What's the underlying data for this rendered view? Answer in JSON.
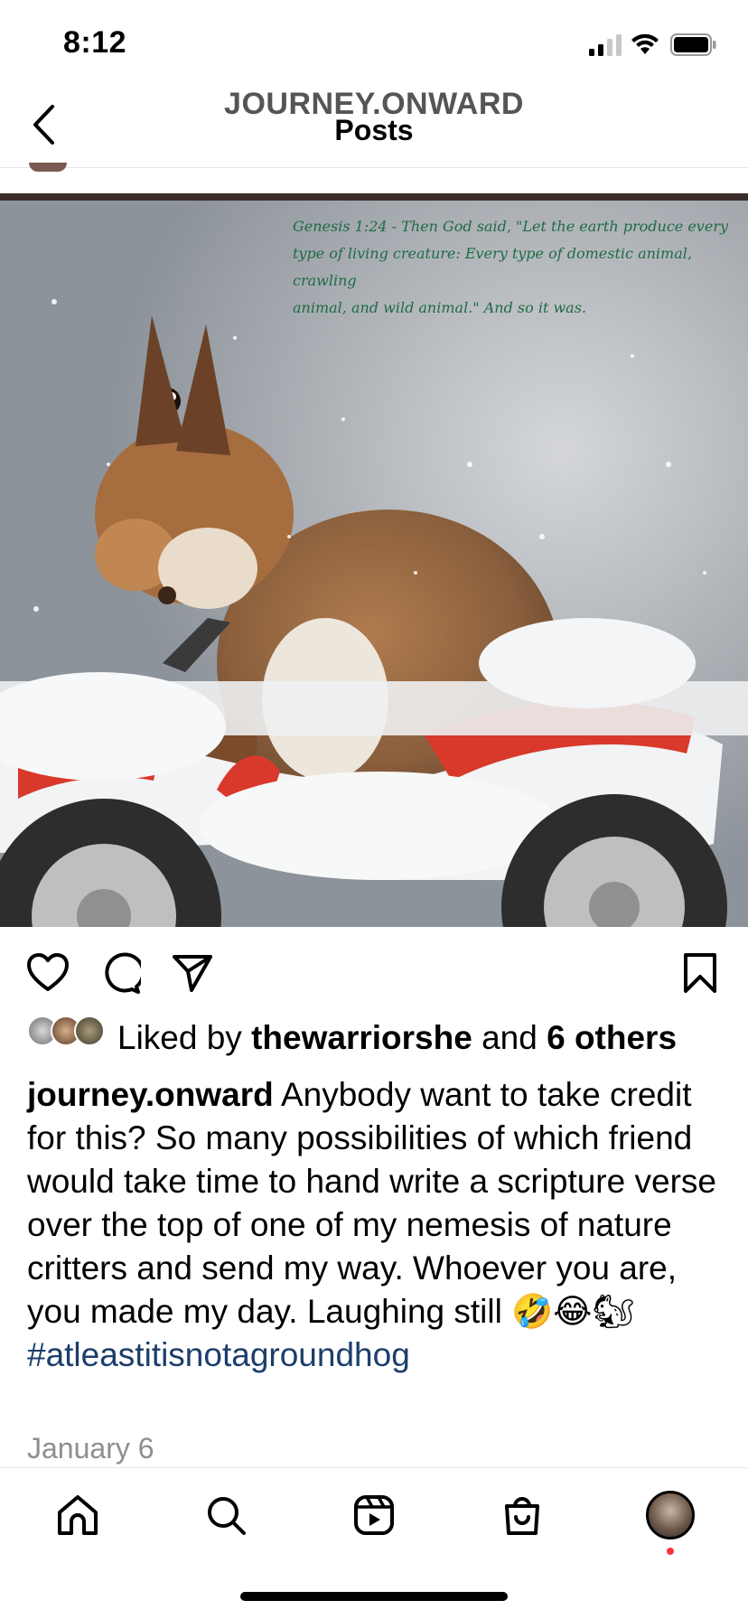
{
  "status_bar": {
    "time": "8:12"
  },
  "header": {
    "username": "JOURNEY.ONWARD",
    "title": "Posts"
  },
  "post": {
    "handwritten_note": [
      "Genesis 1:24 - Then God said, \"Let the earth produce every",
      "type of living creature: Every type of domestic animal, crawling",
      "animal, and wild animal.\" And so it was."
    ],
    "likes": {
      "prefix": "Liked by ",
      "user": "thewarriorshe",
      "middle": " and ",
      "others": "6 others"
    },
    "caption": {
      "username": "journey.onward",
      "text": " Anybody want to take credit for this? So many possibilities of which friend would take time to hand write a scripture verse over the top of one of my nemesis of nature critters and send my way. Whoever you are, you made my day. Laughing still 🤣😂🐿",
      "hashtag": "#atleastitisnotagroundhog"
    },
    "date": "January 6"
  },
  "icons": {
    "back": "chevron-left-icon",
    "like": "heart-icon",
    "comment": "comment-icon",
    "share": "paper-plane-icon",
    "save": "bookmark-icon",
    "nav": [
      "home-icon",
      "search-icon",
      "reels-icon",
      "shop-icon",
      "profile-avatar"
    ]
  },
  "colors": {
    "hashtag": "#1b3e6b",
    "notification": "#ff3040",
    "handwriting": "#1f6a45",
    "atv_red": "#d8392b"
  }
}
